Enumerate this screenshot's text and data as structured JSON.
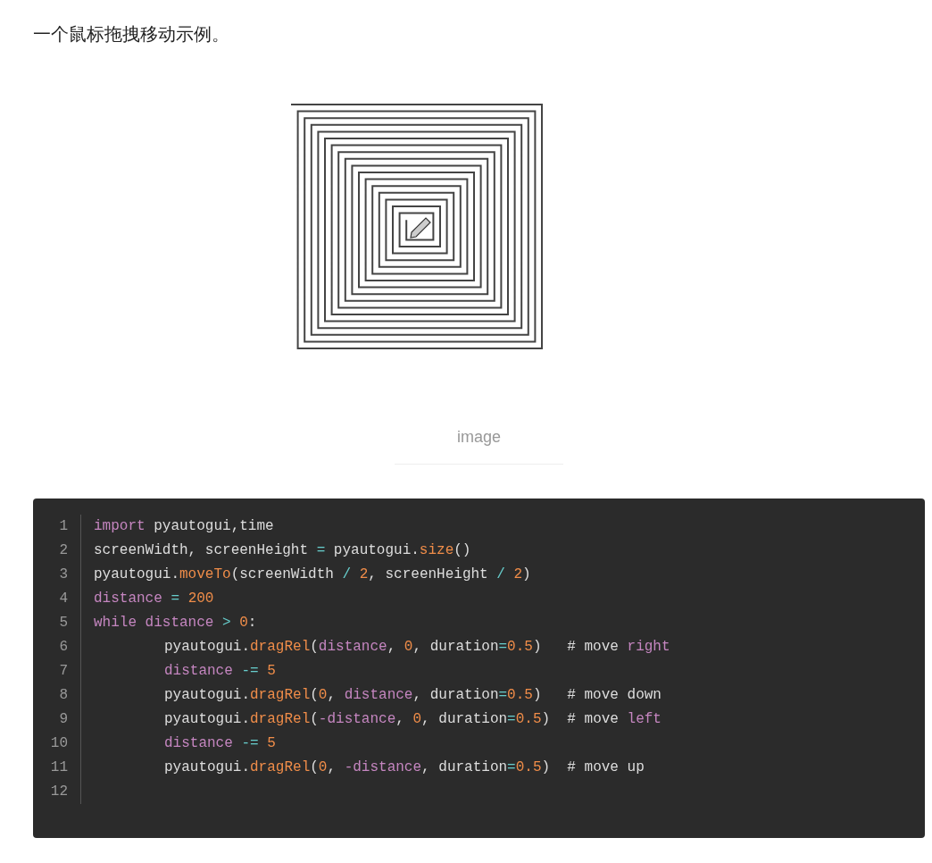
{
  "intro": "一个鼠标拖拽移动示例。",
  "figure": {
    "caption": "image"
  },
  "code": {
    "lines": [
      {
        "number": "1",
        "indented": false,
        "tokens": [
          {
            "kind": "keyword",
            "text": "import"
          },
          {
            "kind": "plain",
            "text": " pyautogui,time"
          }
        ]
      },
      {
        "number": "2",
        "indented": false,
        "tokens": [
          {
            "kind": "plain",
            "text": "screenWidth, screenHeight "
          },
          {
            "kind": "operator",
            "text": "= "
          },
          {
            "kind": "plain",
            "text": "pyautogui."
          },
          {
            "kind": "function",
            "text": "size"
          },
          {
            "kind": "plain",
            "text": "()"
          }
        ]
      },
      {
        "number": "3",
        "indented": false,
        "tokens": [
          {
            "kind": "plain",
            "text": "pyautogui."
          },
          {
            "kind": "function",
            "text": "moveTo"
          },
          {
            "kind": "plain",
            "text": "(screenWidth "
          },
          {
            "kind": "operator",
            "text": "/ "
          },
          {
            "kind": "number",
            "text": "2"
          },
          {
            "kind": "plain",
            "text": ", screenHeight "
          },
          {
            "kind": "operator",
            "text": "/ "
          },
          {
            "kind": "number",
            "text": "2"
          },
          {
            "kind": "plain",
            "text": ")"
          }
        ]
      },
      {
        "number": "4",
        "indented": false,
        "tokens": [
          {
            "kind": "variable",
            "text": "distance"
          },
          {
            "kind": "operator",
            "text": " = "
          },
          {
            "kind": "number",
            "text": "200"
          }
        ]
      },
      {
        "number": "5",
        "indented": false,
        "tokens": [
          {
            "kind": "keyword",
            "text": "while distance"
          },
          {
            "kind": "operator",
            "text": " > "
          },
          {
            "kind": "number",
            "text": "0"
          },
          {
            "kind": "plain",
            "text": ":"
          }
        ]
      },
      {
        "number": "6",
        "indented": true,
        "tokens": [
          {
            "kind": "plain",
            "text": "pyautogui."
          },
          {
            "kind": "function",
            "text": "dragRel"
          },
          {
            "kind": "plain",
            "text": "("
          },
          {
            "kind": "variable",
            "text": "distance"
          },
          {
            "kind": "plain",
            "text": ", "
          },
          {
            "kind": "number",
            "text": "0"
          },
          {
            "kind": "plain",
            "text": ", duration"
          },
          {
            "kind": "operator",
            "text": "="
          },
          {
            "kind": "number",
            "text": "0.5"
          },
          {
            "kind": "plain",
            "text": ")   # move "
          },
          {
            "kind": "keyword",
            "text": "right"
          }
        ]
      },
      {
        "number": "7",
        "indented": true,
        "tokens": [
          {
            "kind": "variable",
            "text": "distance"
          },
          {
            "kind": "operator",
            "text": " -= "
          },
          {
            "kind": "number",
            "text": "5"
          }
        ]
      },
      {
        "number": "8",
        "indented": true,
        "tokens": [
          {
            "kind": "plain",
            "text": "pyautogui."
          },
          {
            "kind": "function",
            "text": "dragRel"
          },
          {
            "kind": "plain",
            "text": "("
          },
          {
            "kind": "number",
            "text": "0"
          },
          {
            "kind": "plain",
            "text": ", "
          },
          {
            "kind": "variable",
            "text": "distance"
          },
          {
            "kind": "plain",
            "text": ", duration"
          },
          {
            "kind": "operator",
            "text": "="
          },
          {
            "kind": "number",
            "text": "0.5"
          },
          {
            "kind": "plain",
            "text": ")   # move down"
          }
        ]
      },
      {
        "number": "9",
        "indented": true,
        "tokens": [
          {
            "kind": "plain",
            "text": "pyautogui."
          },
          {
            "kind": "function",
            "text": "dragRel"
          },
          {
            "kind": "plain",
            "text": "("
          },
          {
            "kind": "variable",
            "text": "-distance"
          },
          {
            "kind": "plain",
            "text": ", "
          },
          {
            "kind": "number",
            "text": "0"
          },
          {
            "kind": "plain",
            "text": ", duration"
          },
          {
            "kind": "operator",
            "text": "="
          },
          {
            "kind": "number",
            "text": "0.5"
          },
          {
            "kind": "plain",
            "text": ")  # move "
          },
          {
            "kind": "keyword",
            "text": "left"
          }
        ]
      },
      {
        "number": "10",
        "indented": true,
        "tokens": [
          {
            "kind": "variable",
            "text": "distance"
          },
          {
            "kind": "operator",
            "text": " -= "
          },
          {
            "kind": "number",
            "text": "5"
          }
        ]
      },
      {
        "number": "11",
        "indented": true,
        "tokens": [
          {
            "kind": "plain",
            "text": "pyautogui."
          },
          {
            "kind": "function",
            "text": "dragRel"
          },
          {
            "kind": "plain",
            "text": "("
          },
          {
            "kind": "number",
            "text": "0"
          },
          {
            "kind": "plain",
            "text": ", "
          },
          {
            "kind": "variable",
            "text": "-distance"
          },
          {
            "kind": "plain",
            "text": ", duration"
          },
          {
            "kind": "operator",
            "text": "="
          },
          {
            "kind": "number",
            "text": "0.5"
          },
          {
            "kind": "plain",
            "text": ")  # move up"
          }
        ]
      },
      {
        "number": "12"
      }
    ]
  }
}
